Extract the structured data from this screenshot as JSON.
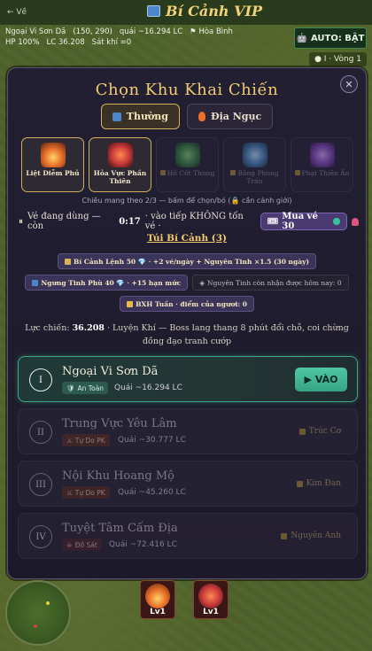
{
  "topbar": {
    "back_label": "← Về",
    "title": "Bí Cảnh VIP"
  },
  "status": {
    "location": "Ngoại Vi Sơn Dã",
    "coords": "(150, 290)",
    "monster_power": "quái ~16.294 LC",
    "faction": "Hòa Bình",
    "hp": "HP 100%",
    "lc": "LC 36.208",
    "kills": "Sát khí =0"
  },
  "auto_label": "AUTO: BẬT",
  "round_label": "● I · Vòng 1",
  "modal": {
    "close_label": "✕",
    "title": "Chọn Khu Khai Chiến",
    "tabs": [
      {
        "label": "Thường",
        "active": true
      },
      {
        "label": "Địa Ngục",
        "active": false
      }
    ],
    "zones": [
      {
        "label": "Liệt Diễm Phủ",
        "locked": false,
        "color": "#e8702a"
      },
      {
        "label": "Hỏa Vực Phần Thiên",
        "locked": false,
        "color": "#c83a3a"
      },
      {
        "label": "Hồ Cốt Thung",
        "locked": true,
        "color": "#3c8a4a"
      },
      {
        "label": "Băng Phong Trấn",
        "locked": true,
        "color": "#4a8ac8"
      },
      {
        "label": "Phạt Thiên Ấn",
        "locked": true,
        "color": "#8a4ac8"
      }
    ],
    "hint": "Chiêu mang theo 2/3 — bấm để chọn/bỏ (🔒 cần cảnh giới)",
    "ticket": {
      "text_pre": "Vé đang dùng — còn",
      "time": "0:17",
      "text_post": "· vào tiếp KHÔNG tốn vé ·",
      "buy_label": "Mua vé 30"
    },
    "bag_link": "Túi Bí Cảnh (3)",
    "badges_row1": [
      {
        "label": "Bí Cảnh Lệnh 50 💎 · +2 vé/ngày + Nguyên Tinh ×1.5 (30 ngày)",
        "dim": false
      }
    ],
    "badges_row2": [
      {
        "label": "Ngưng Tinh Phù 40 💎 · +15 hạn mức",
        "dim": false
      },
      {
        "label": "Nguyên Tinh còn nhận được hôm nay: 0",
        "dim": true
      }
    ],
    "badges_row3": [
      {
        "label": "BXH Tuần · điểm của ngươi: 0",
        "dim": false
      }
    ],
    "power_label": "Lực chiến:",
    "power_value": "36.208",
    "power_text": "· Luyện Khí — Boss lang thang 8 phút đổi chỗ, coi chừng đồng đạo tranh cướp",
    "regions": [
      {
        "roman": "I",
        "name": "Ngoại Vi Sơn Dã",
        "tag": "An Toàn",
        "power": "Quái ~16.294 LC",
        "action": "▶ VÀO",
        "locked": false
      },
      {
        "roman": "II",
        "name": "Trung Vực Yêu Lâm",
        "tag": "Tự Do PK",
        "power": "Quái ~30.777 LC",
        "requirement": "Trúc Cơ",
        "locked": true
      },
      {
        "roman": "III",
        "name": "Nội Khu Hoang Mộ",
        "tag": "Tự Do PK",
        "power": "Quái ~45.260 LC",
        "requirement": "Kim Đan",
        "locked": true
      },
      {
        "roman": "IV",
        "name": "Tuyệt Tâm Cấm Địa",
        "tag": "Đồ Sát",
        "power": "Quái ~72.416 LC",
        "requirement": "Nguyên Anh",
        "locked": true
      }
    ]
  },
  "skills": [
    {
      "level": "Lv1"
    },
    {
      "level": "Lv1"
    }
  ]
}
